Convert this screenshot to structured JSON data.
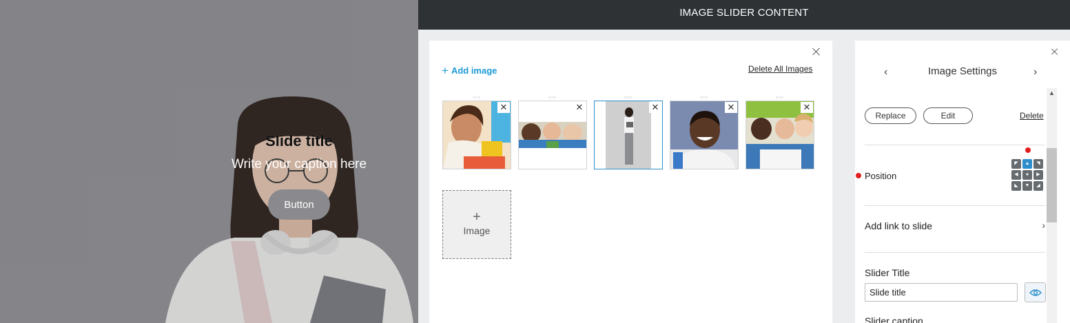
{
  "preview": {
    "slide_title": "Slide title",
    "slide_caption": "Write your caption here",
    "button_label": "Button"
  },
  "header": {
    "title": "IMAGE SLIDER CONTENT"
  },
  "images_panel": {
    "add_image_label": "Add image",
    "delete_all_label": "Delete All Images",
    "remove_symbol": "✕",
    "add_tile_plus": "+",
    "add_tile_label": "Image",
    "thumbnails": [
      {
        "description": "girl-drawing",
        "selected": false
      },
      {
        "description": "kids-reading",
        "selected": false
      },
      {
        "description": "woman-with-tablet",
        "selected": true
      },
      {
        "description": "smiling-boy",
        "selected": false
      },
      {
        "description": "kids-writing",
        "selected": false
      }
    ]
  },
  "settings": {
    "title": "Image Settings",
    "prev_icon": "‹",
    "next_icon": "›",
    "replace_label": "Replace",
    "edit_label": "Edit",
    "delete_label": "Delete",
    "position_label": "Position",
    "position_grid": [
      "◤",
      "▲",
      "◥",
      "◀",
      "●",
      "▶",
      "◣",
      "▼",
      "◢"
    ],
    "position_active": 1,
    "add_link_label": "Add link to slide",
    "add_link_chevron": "›",
    "slider_title_label": "Slider Title",
    "slider_title_value": "Slide title",
    "slider_caption_label": "Slider caption",
    "scroll_up_icon": "▲"
  },
  "colors": {
    "accent": "#2c8fcb",
    "link": "#1e9ad6",
    "header_bg": "#2e3235",
    "marker_red": "#e0201c"
  }
}
